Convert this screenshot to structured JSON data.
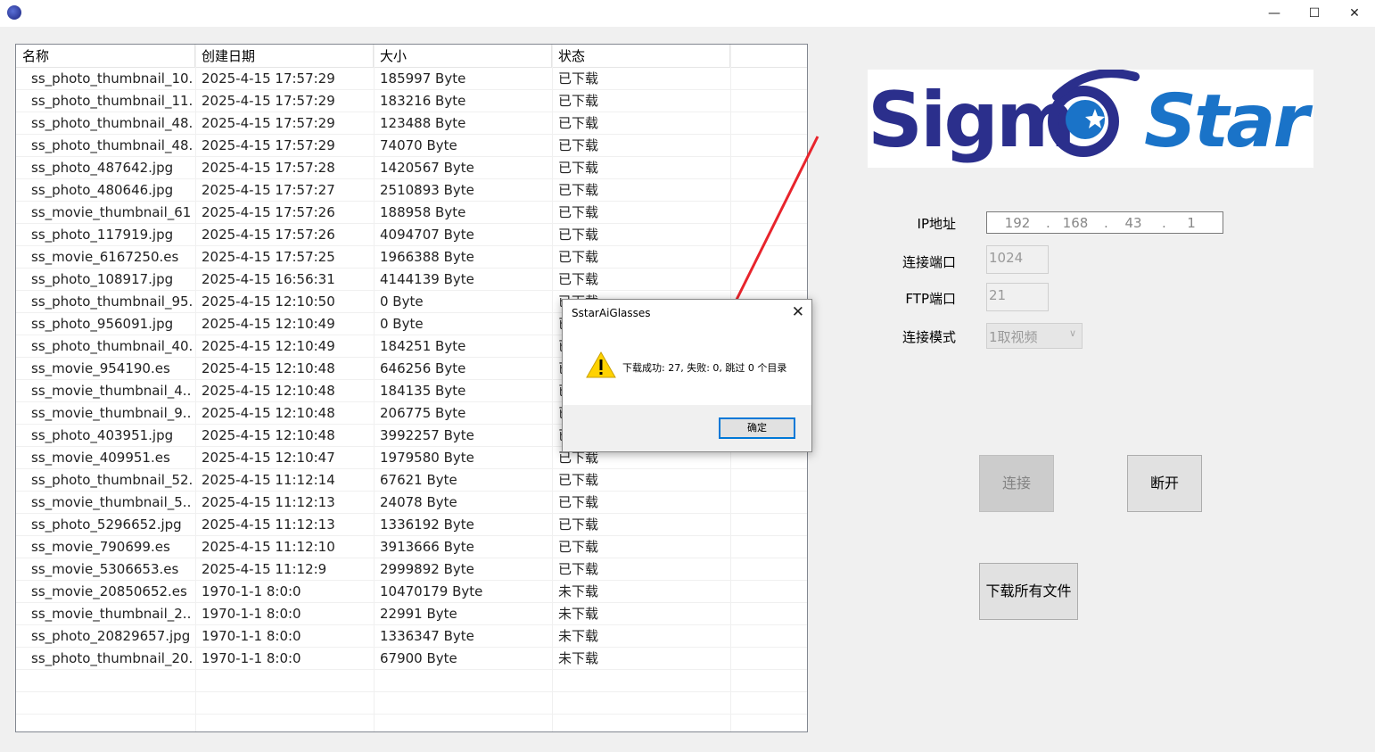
{
  "window": {
    "min_icon": "minimize-icon",
    "max_icon": "maximize-icon",
    "close_icon": "close-icon",
    "min_glyph": "—",
    "max_glyph": "☐",
    "close_glyph": "✕"
  },
  "list": {
    "columns": [
      "名称",
      "创建日期",
      "大小",
      "状态"
    ],
    "rows": [
      [
        "ss_photo_thumbnail_10...",
        "2025-4-15 17:57:29",
        "185997 Byte",
        "已下载"
      ],
      [
        "ss_photo_thumbnail_11...",
        "2025-4-15 17:57:29",
        "183216 Byte",
        "已下载"
      ],
      [
        "ss_photo_thumbnail_48...",
        "2025-4-15 17:57:29",
        "123488 Byte",
        "已下载"
      ],
      [
        "ss_photo_thumbnail_48...",
        "2025-4-15 17:57:29",
        "74070 Byte",
        "已下载"
      ],
      [
        "ss_photo_487642.jpg",
        "2025-4-15 17:57:28",
        "1420567 Byte",
        "已下载"
      ],
      [
        "ss_photo_480646.jpg",
        "2025-4-15 17:57:27",
        "2510893 Byte",
        "已下载"
      ],
      [
        "ss_movie_thumbnail_61...",
        "2025-4-15 17:57:26",
        "188958 Byte",
        "已下载"
      ],
      [
        "ss_photo_117919.jpg",
        "2025-4-15 17:57:26",
        "4094707 Byte",
        "已下载"
      ],
      [
        "ss_movie_6167250.es",
        "2025-4-15 17:57:25",
        "1966388 Byte",
        "已下载"
      ],
      [
        "ss_photo_108917.jpg",
        "2025-4-15 16:56:31",
        "4144139 Byte",
        "已下载"
      ],
      [
        "ss_photo_thumbnail_95...",
        "2025-4-15 12:10:50",
        "0 Byte",
        "已下载"
      ],
      [
        "ss_photo_956091.jpg",
        "2025-4-15 12:10:49",
        "0 Byte",
        "已下载"
      ],
      [
        "ss_photo_thumbnail_40...",
        "2025-4-15 12:10:49",
        "184251 Byte",
        "已下载"
      ],
      [
        "ss_movie_954190.es",
        "2025-4-15 12:10:48",
        "646256 Byte",
        "已下载"
      ],
      [
        "ss_movie_thumbnail_4...",
        "2025-4-15 12:10:48",
        "184135 Byte",
        "已下载"
      ],
      [
        "ss_movie_thumbnail_9...",
        "2025-4-15 12:10:48",
        "206775 Byte",
        "已下载"
      ],
      [
        "ss_photo_403951.jpg",
        "2025-4-15 12:10:48",
        "3992257 Byte",
        "已下载"
      ],
      [
        "ss_movie_409951.es",
        "2025-4-15 12:10:47",
        "1979580 Byte",
        "已下载"
      ],
      [
        "ss_photo_thumbnail_52...",
        "2025-4-15 11:12:14",
        "67621 Byte",
        "已下载"
      ],
      [
        "ss_movie_thumbnail_5...",
        "2025-4-15 11:12:13",
        "24078 Byte",
        "已下载"
      ],
      [
        "ss_photo_5296652.jpg",
        "2025-4-15 11:12:13",
        "1336192 Byte",
        "已下载"
      ],
      [
        "ss_movie_790699.es",
        "2025-4-15 11:12:10",
        "3913666 Byte",
        "已下载"
      ],
      [
        "ss_movie_5306653.es",
        "2025-4-15 11:12:9",
        "2999892 Byte",
        "已下载"
      ],
      [
        "ss_movie_20850652.es",
        "1970-1-1 8:0:0",
        "10470179 Byte",
        "未下载"
      ],
      [
        "ss_movie_thumbnail_2...",
        "1970-1-1 8:0:0",
        "22991 Byte",
        "未下载"
      ],
      [
        "ss_photo_20829657.jpg",
        "1970-1-1 8:0:0",
        "1336347 Byte",
        "未下载"
      ],
      [
        "ss_photo_thumbnail_20...",
        "1970-1-1 8:0:0",
        "67900 Byte",
        "未下载"
      ]
    ]
  },
  "logo": {
    "part1": "Sigm",
    "part2": "Star",
    "accent": "#1a73c8",
    "brand": "#2b2f8c"
  },
  "form": {
    "ip_label": "IP地址",
    "ip": [
      "192",
      "168",
      "43",
      "1"
    ],
    "port_label": "连接端口",
    "port_value": "1024",
    "ftp_label": "FTP端口",
    "ftp_value": "21",
    "mode_label": "连接模式",
    "mode_value": "1取视频"
  },
  "buttons": {
    "connect": "连接",
    "disconnect": "断开",
    "download_all": "下载所有文件"
  },
  "dialog": {
    "title": "SstarAiGlasses",
    "message": "下载成功: 27, 失败: 0, 跳过 0 个目录",
    "ok": "确定",
    "icon": "warning-icon"
  }
}
